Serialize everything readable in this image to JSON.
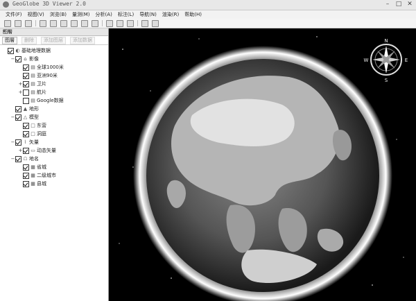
{
  "window": {
    "title": "GeoGlobe 3D Viewer 2.0",
    "buttons": [
      "–",
      "□",
      "✕"
    ]
  },
  "menu": [
    "文件(F)",
    "视图(V)",
    "浏览(B)",
    "量测(M)",
    "分析(A)",
    "标注(L)",
    "导航(N)",
    "渲染(R)",
    "帮助(H)"
  ],
  "panel": {
    "title": "图層",
    "title_buttons": "▾ ✕",
    "tools": [
      {
        "label": "图層",
        "enabled": true
      },
      {
        "label": "删除",
        "enabled": false
      },
      {
        "label": "添加图层",
        "enabled": false
      },
      {
        "label": "添加数据",
        "enabled": false
      }
    ]
  },
  "layers": [
    {
      "label": "基础地理数据",
      "depth": 0,
      "checked": true,
      "icon": "globe-icon",
      "expander": ""
    },
    {
      "label": "影像",
      "depth": 1,
      "checked": true,
      "icon": "folder-icon",
      "expander": "−"
    },
    {
      "label": "全球1000米",
      "depth": 2,
      "checked": true,
      "icon": "image-layer-icon",
      "expander": ""
    },
    {
      "label": "亚洲90米",
      "depth": 2,
      "checked": true,
      "icon": "image-layer-icon",
      "expander": ""
    },
    {
      "label": "卫片",
      "depth": 2,
      "checked": true,
      "icon": "image-layer-icon",
      "expander": "+"
    },
    {
      "label": "航片",
      "depth": 2,
      "checked": false,
      "icon": "image-layer-icon",
      "expander": "+"
    },
    {
      "label": "Google数据",
      "depth": 2,
      "checked": false,
      "icon": "image-layer-icon",
      "expander": ""
    },
    {
      "label": "地形",
      "depth": 1,
      "checked": true,
      "icon": "terrain-icon",
      "expander": ""
    },
    {
      "label": "模型",
      "depth": 1,
      "checked": true,
      "icon": "model-icon",
      "expander": "−"
    },
    {
      "label": "东营",
      "depth": 2,
      "checked": true,
      "icon": "model-layer-icon",
      "expander": ""
    },
    {
      "label": "洞庭",
      "depth": 2,
      "checked": true,
      "icon": "model-layer-icon",
      "expander": ""
    },
    {
      "label": "矢量",
      "depth": 1,
      "checked": true,
      "icon": "vector-icon",
      "expander": "−"
    },
    {
      "label": "动态矢量",
      "depth": 2,
      "checked": true,
      "icon": "vector-layer-icon",
      "expander": "+"
    },
    {
      "label": "地名",
      "depth": 1,
      "checked": true,
      "icon": "placename-icon",
      "expander": "−"
    },
    {
      "label": "省城",
      "depth": 2,
      "checked": true,
      "icon": "placename-layer-icon",
      "expander": ""
    },
    {
      "label": "二级城市",
      "depth": 2,
      "checked": true,
      "icon": "placename-layer-icon",
      "expander": ""
    },
    {
      "label": "县城",
      "depth": 2,
      "checked": true,
      "icon": "placename-layer-icon",
      "expander": ""
    }
  ],
  "compass": {
    "north": "N",
    "east": "E",
    "south": "S",
    "west": "W"
  }
}
